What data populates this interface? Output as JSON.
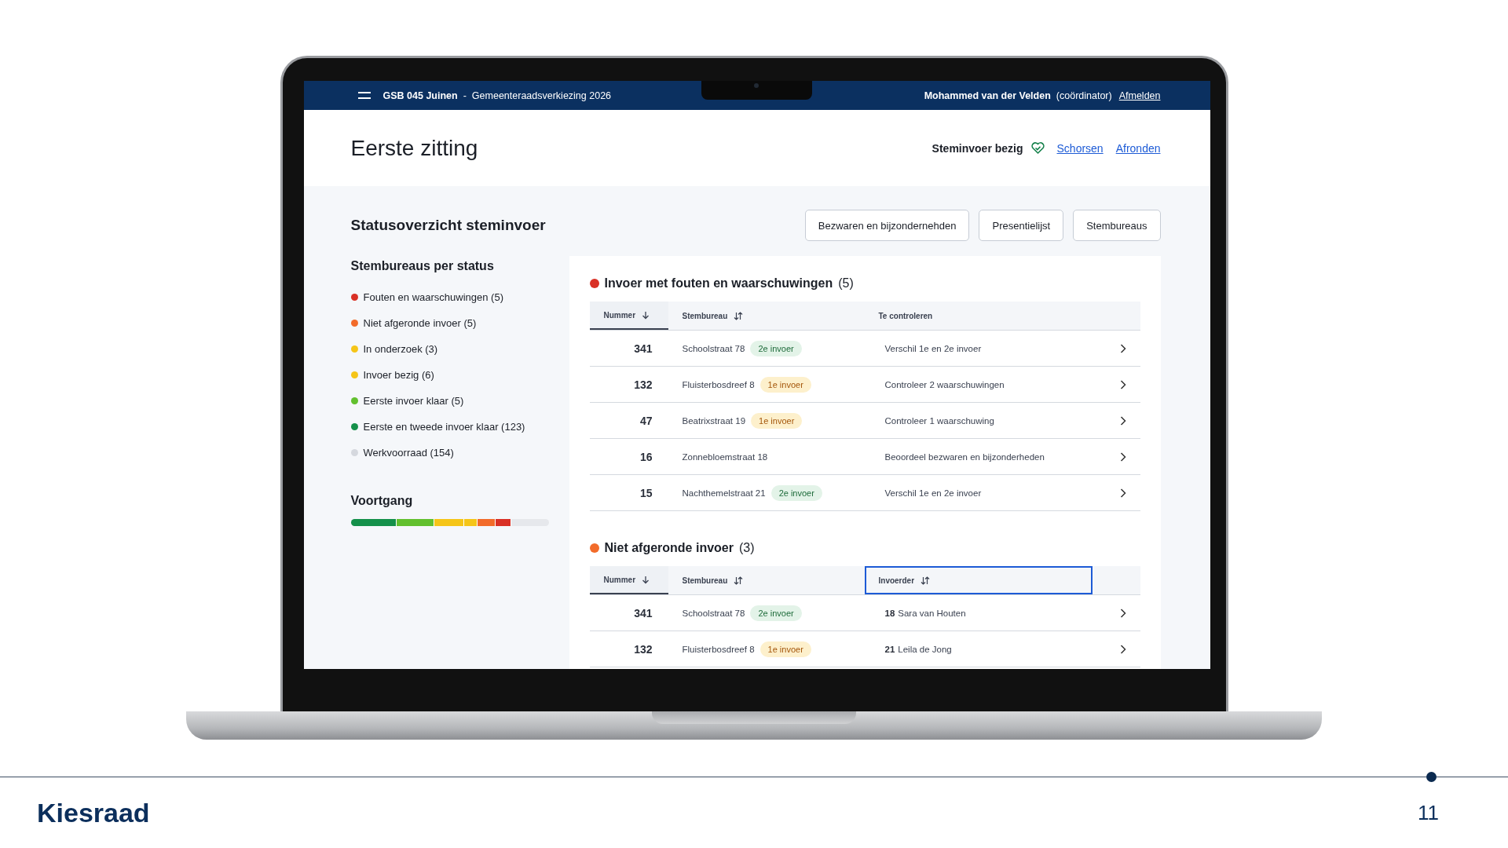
{
  "navbar": {
    "station": "GSB 045 Juinen",
    "separator": "-",
    "election": "Gemeenteraadsverkiezing 2026",
    "user": "Mohammed van der Velden",
    "role": "(coördinator)",
    "logout": "Afmelden"
  },
  "header": {
    "title": "Eerste zitting",
    "status": "Steminvoer bezig",
    "links": [
      "Schorsen",
      "Afronden"
    ]
  },
  "overview": {
    "title": "Statusoverzicht steminvoer",
    "buttons": [
      "Bezwaren en bijzondernehden",
      "Presentielijst",
      "Stembureaus"
    ]
  },
  "sidebar": {
    "legend_title": "Stembureaus per status",
    "legend": [
      {
        "label": "Fouten en waarschuwingen (5)",
        "color": "#d93025"
      },
      {
        "label": "Niet afgeronde invoer (5)",
        "color": "#f26b2a"
      },
      {
        "label": "In onderzoek (3)",
        "color": "#f5c518"
      },
      {
        "label": "Invoer bezig (6)",
        "color": "#f5c518"
      },
      {
        "label": "Eerste invoer klaar (5)",
        "color": "#62c02e"
      },
      {
        "label": "Eerste en tweede invoer klaar (123)",
        "color": "#14904a"
      },
      {
        "label": "Werkvoorraad (154)",
        "color": "#d5d8de"
      }
    ],
    "progress_title": "Voortgang",
    "progress": {
      "level": 0.81
    }
  },
  "sections": [
    {
      "title": "Invoer met fouten en waarschuwingen",
      "count": "(5)",
      "color": "#d93025",
      "columns": [
        {
          "label": "Nummer",
          "sortable": true,
          "sorted": true,
          "focused": false
        },
        {
          "label": "Stembureau",
          "sortable": true,
          "sorted": false,
          "focused": false
        },
        {
          "label": "Te controleren",
          "sortable": false,
          "sorted": false,
          "focused": false
        }
      ],
      "rows": [
        {
          "number": "341",
          "location": "Schoolstraat 78",
          "badge": {
            "label": "2e invoer",
            "kind": "second"
          },
          "detail": "Verschil 1e en 2e invoer"
        },
        {
          "number": "132",
          "location": "Fluisterbosdreef 8",
          "badge": {
            "label": "1e invoer",
            "kind": "first"
          },
          "detail": "Controleer 2 waarschuwingen"
        },
        {
          "number": "47",
          "location": "Beatrixstraat 19",
          "badge": {
            "label": "1e invoer",
            "kind": "first"
          },
          "detail": "Controleer 1 waarschuwing"
        },
        {
          "number": "16",
          "location": "Zonnebloemstraat 18",
          "detail": "Beoordeel bezwaren en bijzonderheden"
        },
        {
          "number": "15",
          "location": "Nachthemelstraat 21",
          "badge": {
            "label": "2e invoer",
            "kind": "second"
          },
          "detail": "Verschil 1e en 2e invoer"
        }
      ]
    },
    {
      "title": "Niet afgeronde invoer",
      "count": "(3)",
      "color": "#f26b2a",
      "columns": [
        {
          "label": "Nummer",
          "sortable": true,
          "sorted": true,
          "focused": false
        },
        {
          "label": "Stembureau",
          "sortable": true,
          "sorted": false,
          "focused": false
        },
        {
          "label": "Invoerder",
          "sortable": true,
          "sorted": false,
          "focused": true
        }
      ],
      "rows": [
        {
          "number": "341",
          "location": "Schoolstraat 78",
          "badge": {
            "label": "2e invoer",
            "kind": "second"
          },
          "detail_number": "18",
          "detail": "Sara van Houten"
        },
        {
          "number": "132",
          "location": "Fluisterbosdreef 8",
          "badge": {
            "label": "1e invoer",
            "kind": "first"
          },
          "detail_number": "21",
          "detail": "Leila de Jong"
        }
      ]
    }
  ],
  "footer": {
    "logo": "Kiesraad",
    "page": "11"
  }
}
